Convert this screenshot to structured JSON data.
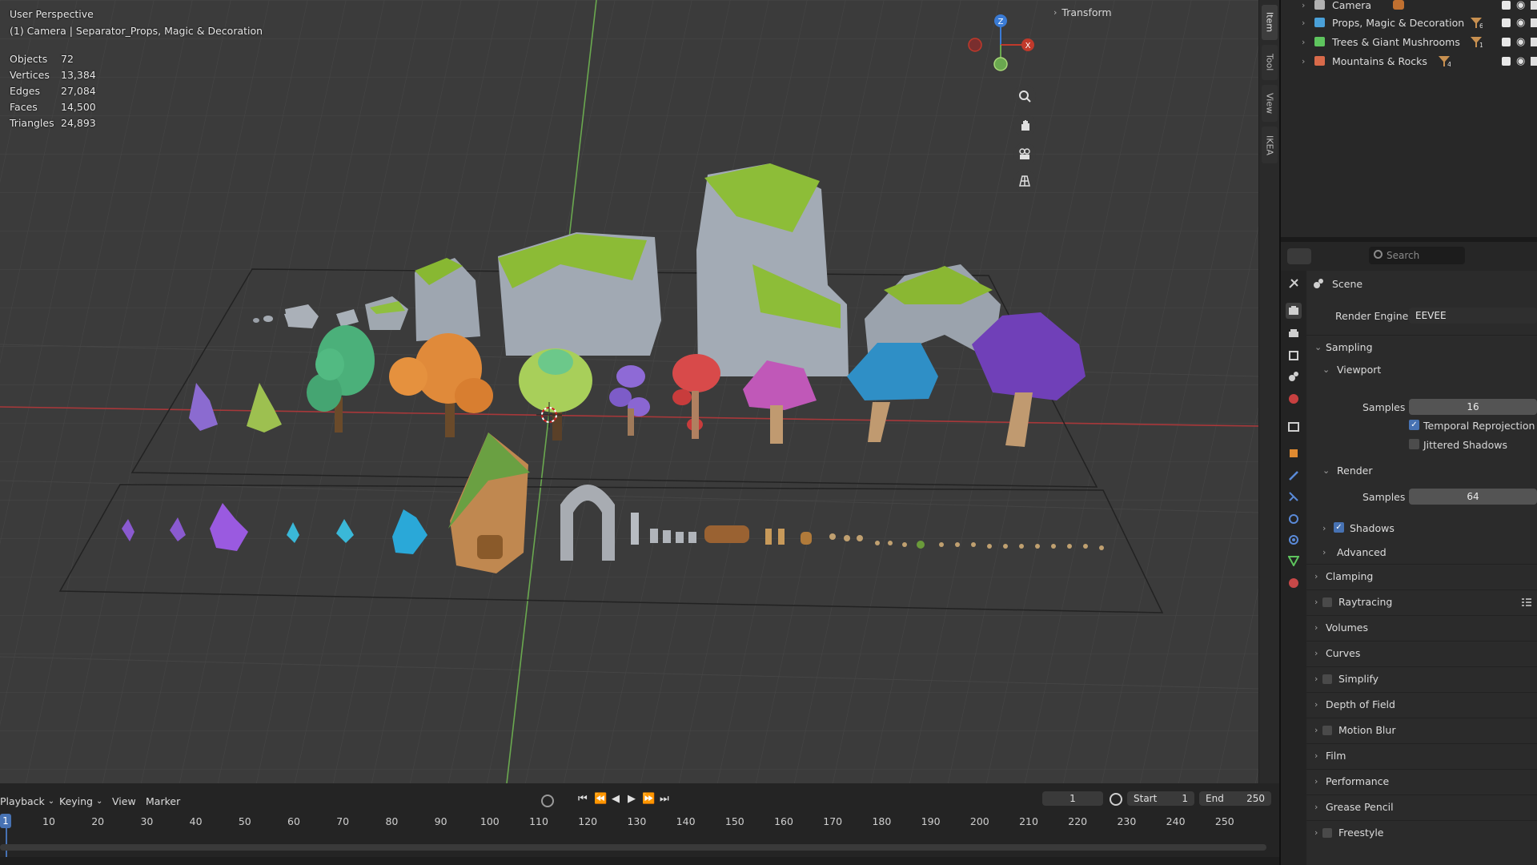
{
  "viewport": {
    "perspective": "User Perspective",
    "context": "(1) Camera | Separator_Props, Magic & Decoration",
    "stats": [
      {
        "label": "Objects",
        "value": "72"
      },
      {
        "label": "Vertices",
        "value": "13,384"
      },
      {
        "label": "Edges",
        "value": "27,084"
      },
      {
        "label": "Faces",
        "value": "14,500"
      },
      {
        "label": "Triangles",
        "value": "24,893"
      }
    ],
    "gizmo": {
      "z": "Z",
      "x": "X"
    },
    "nav_icons": [
      "zoom-icon",
      "pan-hand-icon",
      "camera-view-icon",
      "ortho-grid-icon"
    ]
  },
  "sidebar": {
    "header": "Transform",
    "tabs": [
      "Item",
      "Tool",
      "View",
      "IKEA"
    ]
  },
  "outliner": {
    "rows": [
      {
        "label": "Camera",
        "color": "#b0b0b0"
      },
      {
        "label": "Props, Magic & Decoration",
        "color": "#4aa0d8",
        "badge": "6"
      },
      {
        "label": "Trees & Giant Mushrooms",
        "color": "#5ec45e",
        "badge": "1"
      },
      {
        "label": "Mountains & Rocks",
        "color": "#d86a4a",
        "badge": "4"
      }
    ]
  },
  "properties": {
    "search_placeholder": "Search",
    "context_title": "Scene",
    "render_engine_label": "Render Engine",
    "render_engine_value": "EEVEE",
    "sampling": "Sampling",
    "viewport": "Viewport",
    "viewport_samples_label": "Samples",
    "viewport_samples": "16",
    "temporal_reprojection": "Temporal Reprojection",
    "jittered_shadows": "Jittered Shadows",
    "render": "Render",
    "render_samples_label": "Samples",
    "render_samples": "64",
    "shadows": "Shadows",
    "advanced": "Advanced",
    "panels": [
      "Clamping",
      "Raytracing",
      "Volumes",
      "Curves",
      "Simplify",
      "Depth of Field",
      "Motion Blur",
      "Film",
      "Performance",
      "Grease Pencil",
      "Freestyle"
    ]
  },
  "timeline": {
    "menus": [
      "Playback",
      "Keying",
      "View",
      "Marker"
    ],
    "current_frame": "1",
    "start_label": "Start",
    "start_value": "1",
    "end_label": "End",
    "end_value": "250",
    "frame_indicator": "1",
    "ticks": [
      "10",
      "20",
      "30",
      "40",
      "50",
      "60",
      "70",
      "80",
      "90",
      "100",
      "110",
      "120",
      "130",
      "140",
      "150",
      "160",
      "170",
      "180",
      "190",
      "200",
      "210",
      "220",
      "230",
      "240",
      "250"
    ]
  },
  "colors": {
    "accent": "#4772b3",
    "x_axis": "#c0392b",
    "y_axis": "#6aa84f",
    "z_axis": "#3a7bd5"
  }
}
